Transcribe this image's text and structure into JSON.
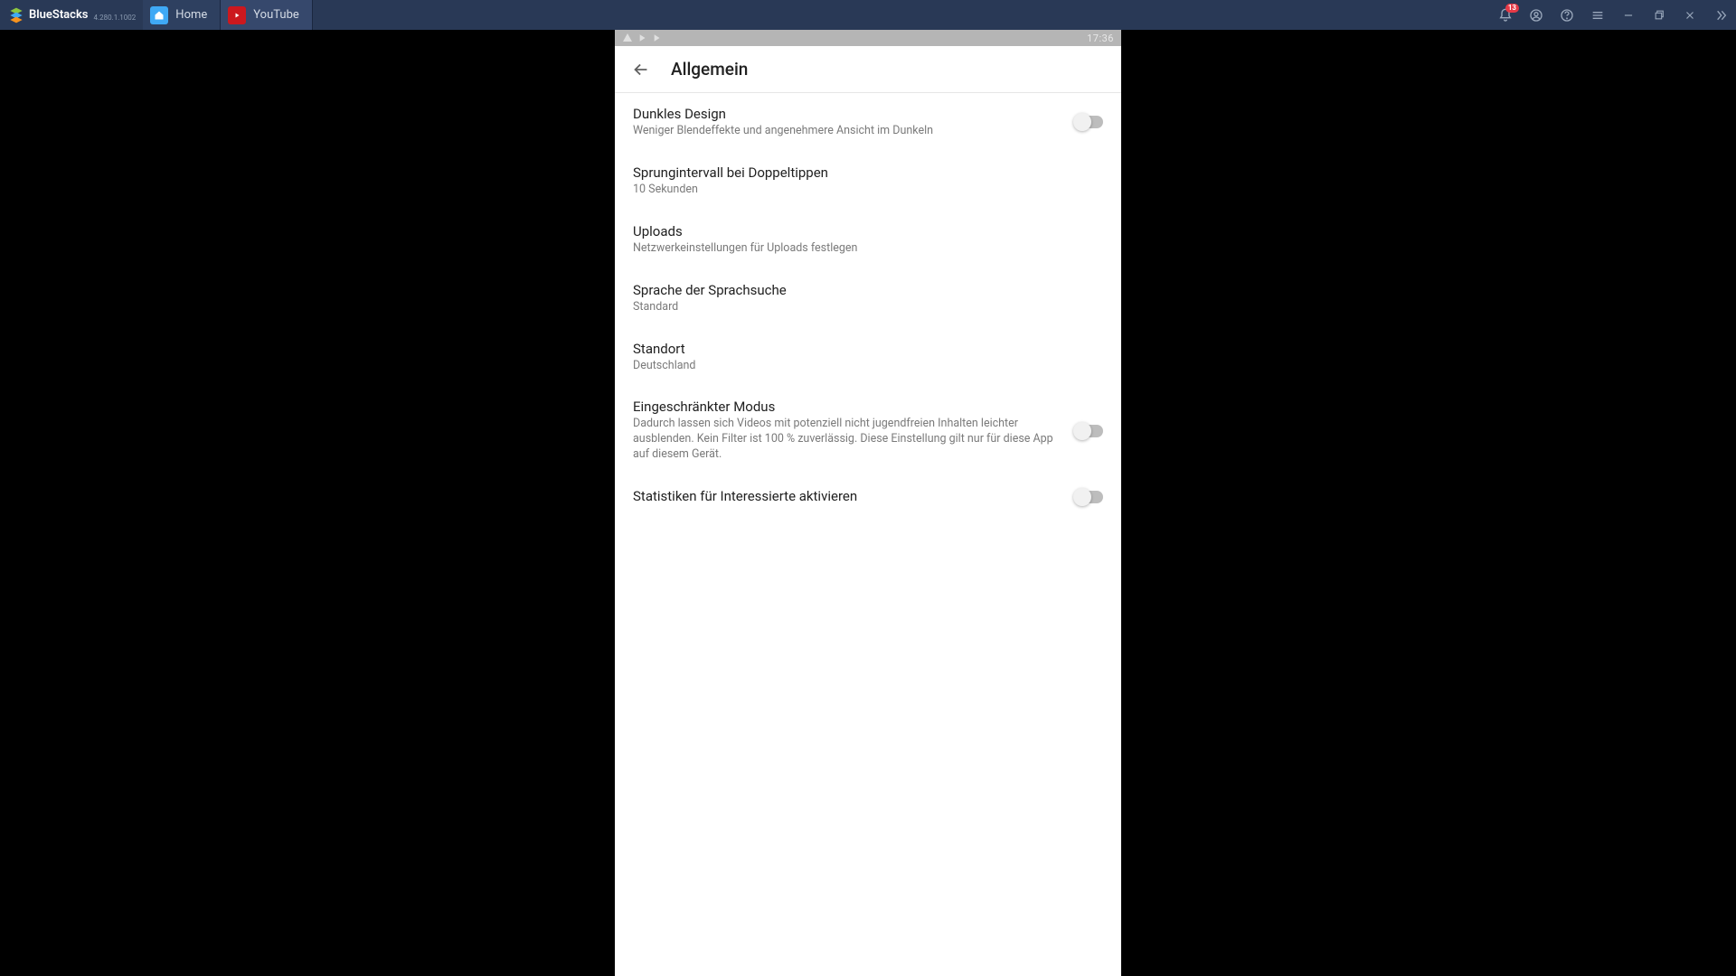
{
  "titlebar": {
    "brand": "BlueStacks",
    "version": "4.280.1.1002",
    "tabs": [
      {
        "label": "Home"
      },
      {
        "label": "YouTube"
      }
    ],
    "notification_count": "13"
  },
  "statusbar": {
    "time": "17:36"
  },
  "app": {
    "header_title": "Allgemein"
  },
  "settings": [
    {
      "title": "Dunkles Design",
      "sub": "Weniger Blendeffekte und angenehmere Ansicht im Dunkeln",
      "toggle": true
    },
    {
      "title": "Sprungintervall bei Doppeltippen",
      "sub": "10 Sekunden",
      "toggle": false
    },
    {
      "title": "Uploads",
      "sub": "Netzwerkeinstellungen für Uploads festlegen",
      "toggle": false
    },
    {
      "title": "Sprache der Sprachsuche",
      "sub": "Standard",
      "toggle": false
    },
    {
      "title": "Standort",
      "sub": "Deutschland",
      "toggle": false
    },
    {
      "title": "Eingeschränkter Modus",
      "sub": "Dadurch lassen sich Videos mit potenziell nicht jugendfreien Inhalten leichter ausblenden. Kein Filter ist 100 % zuverlässig. Diese Einstellung gilt nur für diese App auf diesem Gerät.",
      "toggle": true
    },
    {
      "title": "Statistiken für Interessierte aktivieren",
      "sub": "",
      "toggle": true
    }
  ]
}
